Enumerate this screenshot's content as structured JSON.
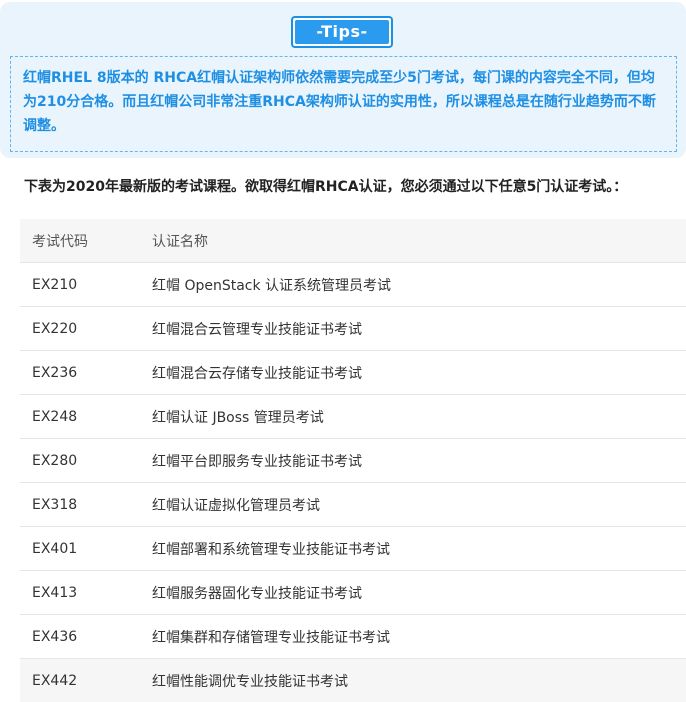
{
  "tips": {
    "badge_label": "-Tips-",
    "text": "红帽RHEL 8版本的 RHCA红帽认证架构师依然需要完成至少5门考试，每门课的内容完全不同，但均为210分合格。而且红帽公司非常注重RHCA架构师认证的实用性，所以课程总是在随行业趋势而不断调整。"
  },
  "intro": "下表为2020年最新版的考试课程。欲取得红帽RHCA认证，您必须通过以下任意5门认证考试。：",
  "table": {
    "headers": [
      "考试代码",
      "认证名称"
    ],
    "rows": [
      {
        "code": "EX210",
        "name": "红帽 OpenStack 认证系统管理员考试"
      },
      {
        "code": "EX220",
        "name": "红帽混合云管理专业技能证书考试"
      },
      {
        "code": "EX236",
        "name": "红帽混合云存储专业技能证书考试"
      },
      {
        "code": "EX248",
        "name": "红帽认证 JBoss 管理员考试"
      },
      {
        "code": "EX280",
        "name": "红帽平台即服务专业技能证书考试"
      },
      {
        "code": "EX318",
        "name": "红帽认证虚拟化管理员考试"
      },
      {
        "code": "EX401",
        "name": "红帽部署和系统管理专业技能证书考试"
      },
      {
        "code": "EX413",
        "name": "红帽服务器固化专业技能证书考试"
      },
      {
        "code": "EX436",
        "name": "红帽集群和存储管理专业技能证书考试"
      },
      {
        "code": "EX442",
        "name": "红帽性能调优专业技能证书考试"
      }
    ]
  },
  "colors": {
    "accent": "#2b9bef",
    "tips_text": "#1e8fe3",
    "panel_bg": "#eaf4fd"
  }
}
